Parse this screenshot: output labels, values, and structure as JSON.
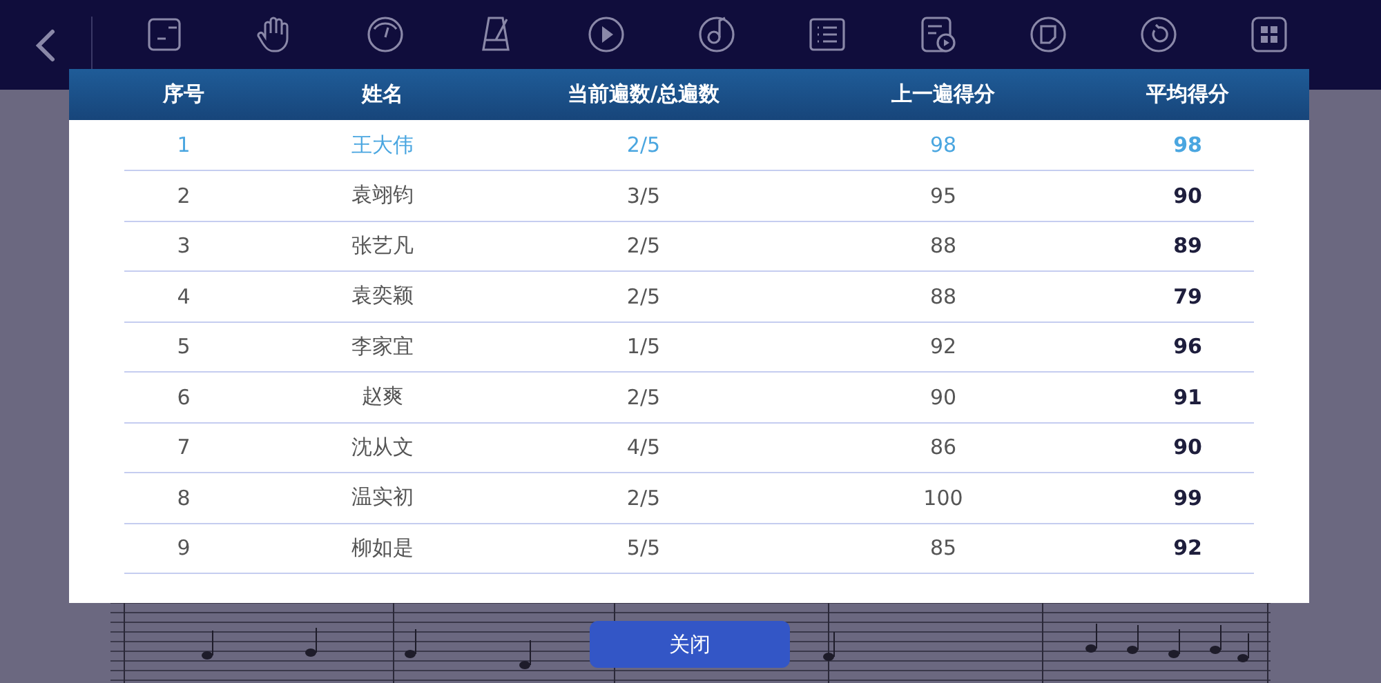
{
  "toolbar": {
    "tools": [
      {
        "kind": "ab"
      },
      {
        "kind": "hand"
      },
      {
        "kind": "gauge"
      },
      {
        "kind": "metronome"
      },
      {
        "kind": "play"
      },
      {
        "kind": "note"
      },
      {
        "kind": "list"
      },
      {
        "kind": "trial"
      },
      {
        "kind": "practice"
      },
      {
        "kind": "reset"
      },
      {
        "kind": "console"
      }
    ]
  },
  "dialog": {
    "table": {
      "columns": [
        "序号",
        "姓名",
        "当前遍数/总遍数",
        "上一遍得分",
        "平均得分"
      ],
      "rows": [
        {
          "selected": true,
          "cells": [
            "1",
            "王大伟",
            "2/5",
            "98",
            "98"
          ]
        },
        {
          "selected": false,
          "cells": [
            "2",
            "袁翊钧",
            "3/5",
            "95",
            "90"
          ]
        },
        {
          "selected": false,
          "cells": [
            "3",
            "张艺凡",
            "2/5",
            "88",
            "89"
          ]
        },
        {
          "selected": false,
          "cells": [
            "4",
            "袁奕颖",
            "2/5",
            "88",
            "79"
          ]
        },
        {
          "selected": false,
          "cells": [
            "5",
            "李家宜",
            "1/5",
            "92",
            "96"
          ]
        },
        {
          "selected": false,
          "cells": [
            "6",
            "赵爽",
            "2/5",
            "90",
            "91"
          ]
        },
        {
          "selected": false,
          "cells": [
            "7",
            "沈从文",
            "4/5",
            "86",
            "90"
          ]
        },
        {
          "selected": false,
          "cells": [
            "8",
            "温实初",
            "2/5",
            "100",
            "99"
          ]
        },
        {
          "selected": false,
          "cells": [
            "9",
            "柳如是",
            "5/5",
            "85",
            "92"
          ]
        }
      ]
    },
    "close_button": "关闭"
  }
}
